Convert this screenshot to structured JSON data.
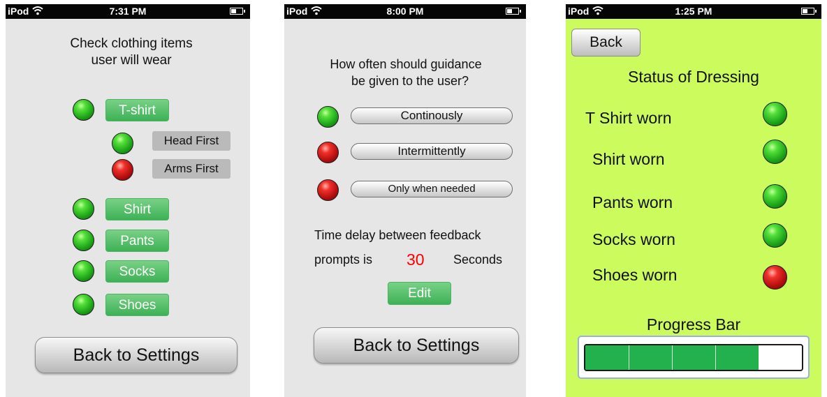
{
  "status_bar": {
    "screen1": {
      "carrier": "iPod",
      "time": "7:31 PM"
    },
    "screen2": {
      "carrier": "iPod",
      "time": "8:00 PM"
    },
    "screen3": {
      "carrier": "iPod",
      "time": "1:25 PM"
    }
  },
  "icons": {
    "wifi": "wifi-icon",
    "battery": "battery-icon",
    "indicator_on": "green-indicator-light",
    "indicator_off": "red-indicator-light"
  },
  "colors": {
    "indicator_on": "#1fa81a",
    "indicator_off": "#d11a1a",
    "item_button": "#4cb964",
    "delay_value": "#ff0000",
    "status_background": "#ccfb5e",
    "progress_fill": "#23b14d"
  },
  "clothing_screen": {
    "prompt_line1": "Check clothing items",
    "prompt_line2": "user will wear",
    "items": [
      {
        "label": "T-shirt",
        "state": "on"
      },
      {
        "label": "Shirt",
        "state": "on"
      },
      {
        "label": "Pants",
        "state": "on"
      },
      {
        "label": "Socks",
        "state": "on"
      },
      {
        "label": "Shoes",
        "state": "on"
      }
    ],
    "tshirt_options": [
      {
        "label": "Head First",
        "state": "on"
      },
      {
        "label": "Arms First",
        "state": "off"
      }
    ],
    "back_button": "Back to Settings"
  },
  "guidance_screen": {
    "prompt_line1": "How often should guidance",
    "prompt_line2": "be given to the user?",
    "options": [
      {
        "label": "Continously",
        "state": "on"
      },
      {
        "label": "Intermittently",
        "state": "off"
      },
      {
        "label": "Only when needed",
        "state": "off"
      }
    ],
    "delay_line1": "Time delay between feedback",
    "delay_prefix": "prompts is",
    "delay_value": "30",
    "delay_unit": "Seconds",
    "edit_button": "Edit",
    "back_button": "Back to Settings"
  },
  "status_screen": {
    "back_button": "Back",
    "title": "Status of Dressing",
    "items": [
      {
        "label": "T Shirt worn",
        "state": "on"
      },
      {
        "label": "Shirt worn",
        "state": "on"
      },
      {
        "label": "Pants worn",
        "state": "on"
      },
      {
        "label": "Socks worn",
        "state": "on"
      },
      {
        "label": "Shoes worn",
        "state": "off"
      }
    ],
    "progress_label": "Progress Bar",
    "progress": {
      "completed": 4,
      "total": 5
    }
  }
}
